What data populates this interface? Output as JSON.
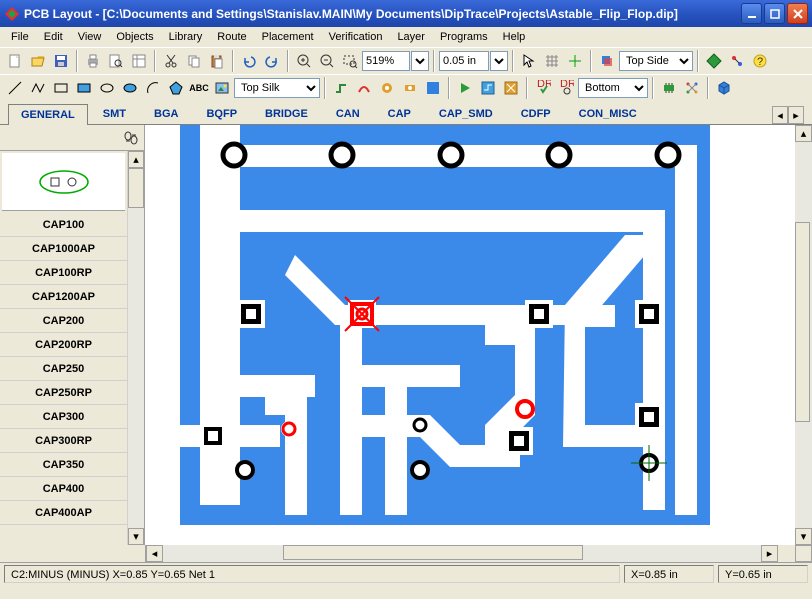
{
  "window": {
    "title": "PCB Layout - [C:\\Documents and Settings\\Stanislav.MAIN\\My Documents\\DipTrace\\Projects\\Astable_Flip_Flop.dip]"
  },
  "menu": [
    "File",
    "Edit",
    "View",
    "Objects",
    "Library",
    "Route",
    "Placement",
    "Verification",
    "Layer",
    "Programs",
    "Help"
  ],
  "toolbar1": {
    "zoom_value": "519%",
    "grid_value": "0.05 in",
    "layer_value": "Top Side"
  },
  "toolbar2": {
    "layer_value": "Top Silk",
    "side_value": "Bottom"
  },
  "tabs": {
    "items": [
      "GENERAL",
      "SMT",
      "BGA",
      "BQFP",
      "BRIDGE",
      "CAN",
      "CAP",
      "CAP_SMD",
      "CDFP",
      "CON_MISC"
    ],
    "active": 0
  },
  "sidebar": {
    "items": [
      "CAP100",
      "CAP1000AP",
      "CAP100RP",
      "CAP1200AP",
      "CAP200",
      "CAP200RP",
      "CAP250",
      "CAP250RP",
      "CAP300",
      "CAP300RP",
      "CAP350",
      "CAP400",
      "CAP400AP"
    ]
  },
  "status": {
    "main": "C2:MINUS (MINUS)    X=0.85  Y=0.65   Net 1",
    "x": "X=0.85 in",
    "y": "Y=0.65 in"
  },
  "colors": {
    "copper": "#2f7de0",
    "pcb_fill": "#3b89e8",
    "pad_ring": "#000",
    "pad_hole": "#fff",
    "highlight": "#f00",
    "silk": "#0c0"
  }
}
